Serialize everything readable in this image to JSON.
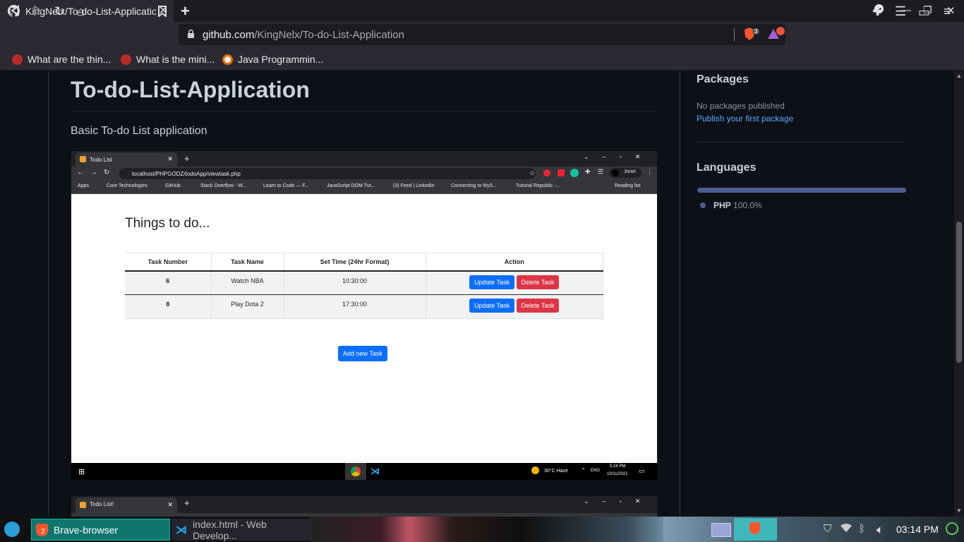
{
  "browser": {
    "tab_title": "KingNelx/To-do-List-Application",
    "url_domain": "github.com",
    "url_path": "/KingNelx/To-do-List-Application",
    "shield_count": "3",
    "bookmarks": [
      "What are the thin...",
      "What is the mini...",
      "Java Programmin..."
    ]
  },
  "readme": {
    "title": "To-do-List-Application",
    "description": "Basic To-do List application"
  },
  "screenshot": {
    "tab": "Todo List",
    "url": "localhost/PHPGODZ/todoApp/viewtask.php",
    "profile": "Jonel",
    "bookmarks": [
      "Apps",
      "Core Technologies",
      "GitHub",
      "Stack Overflow - W...",
      "Learn to Code — F...",
      "JavaScript DOM Tut...",
      "(3) Feed | LinkedIn",
      "Connecting to MyS...",
      "Tutorial Republic -...",
      "Reading list"
    ],
    "heading": "Things to do...",
    "columns": [
      "Task Number",
      "Task Name",
      "Set Time (24hr Format)",
      "Action"
    ],
    "rows": [
      {
        "number": "6",
        "name": "Watch NBA",
        "time": "10:30:00"
      },
      {
        "number": "8",
        "name": "Play Dota 2",
        "time": "17:30:00"
      }
    ],
    "update_label": "Update Task",
    "delete_label": "Delete Task",
    "add_label": "Add new Task",
    "weather": "30°C  Haze",
    "lang": "ENG",
    "time": "5:24 PM",
    "date": "10/11/2021",
    "second_tab": "Todo List!"
  },
  "sidebar": {
    "packages_title": "Packages",
    "packages_text": "No packages published",
    "packages_link": "Publish your first package",
    "languages_title": "Languages",
    "language_name": "PHP",
    "language_pct": "100.0%",
    "language_share": 1.0,
    "language_color": "#4F5D95"
  },
  "taskbar": {
    "brave_label": "Brave-browser",
    "brave_count": "2",
    "code_label": "index.html - Web Develop...",
    "clock": "03:14 PM"
  }
}
